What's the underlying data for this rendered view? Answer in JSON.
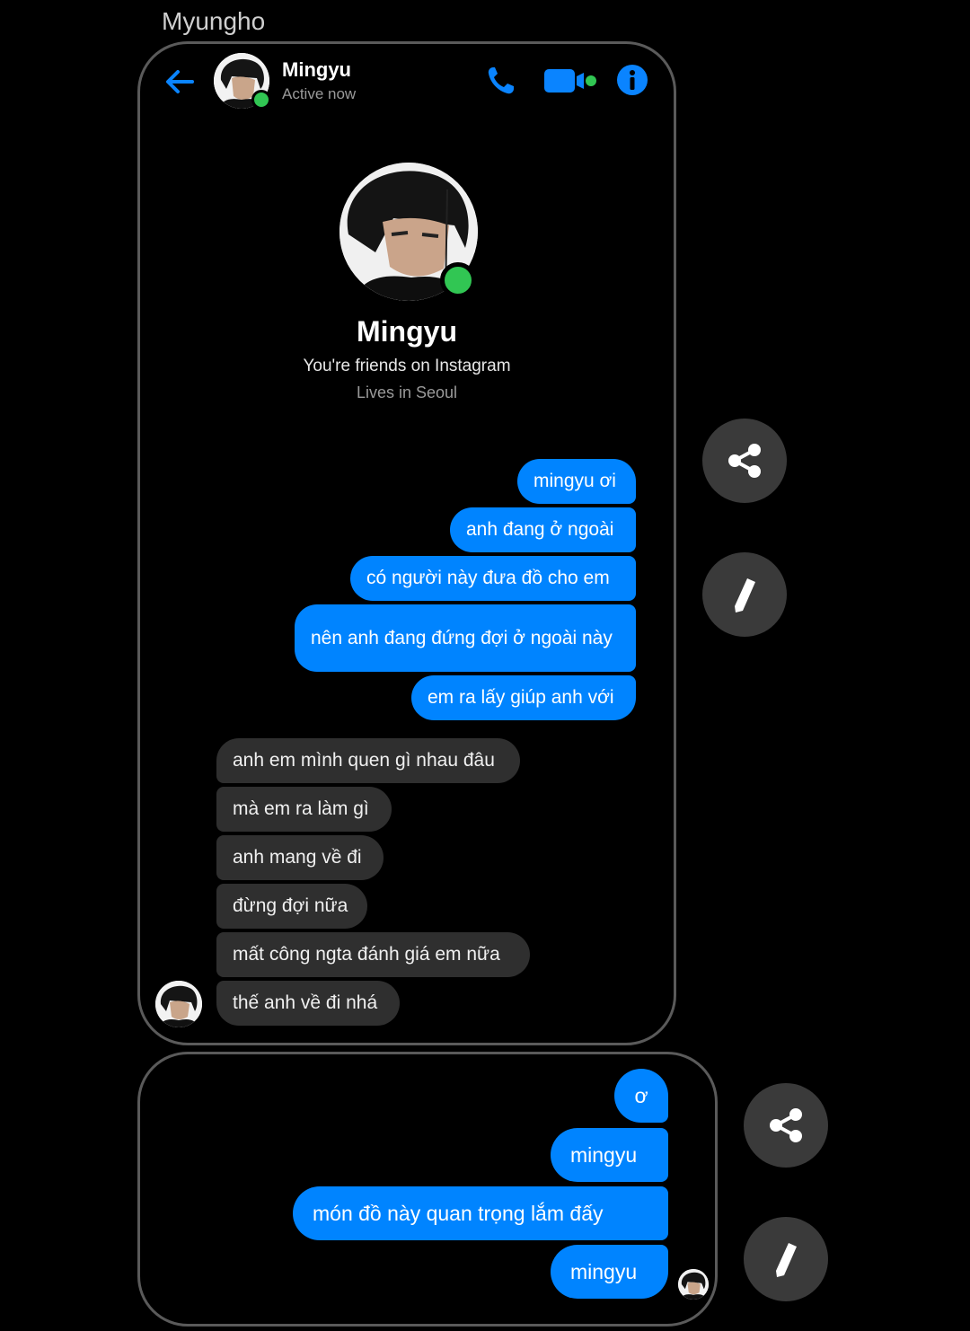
{
  "sender": "Myungho",
  "header": {
    "name": "Mingyu",
    "status": "Active now"
  },
  "profile": {
    "name": "Mingyu",
    "friends": "You're friends on Instagram",
    "location": "Lives in Seoul"
  },
  "messages1": [
    {
      "dir": "out",
      "text": "mingyu ơi"
    },
    {
      "dir": "out",
      "text": "anh đang ở ngoài"
    },
    {
      "dir": "out",
      "text": "có người này đưa đồ cho em"
    },
    {
      "dir": "out",
      "text": "nên anh đang đứng đợi ở ngoài này"
    },
    {
      "dir": "out",
      "text": "em ra lấy giúp anh với"
    },
    {
      "dir": "in",
      "text": "anh em mình quen gì nhau đâu"
    },
    {
      "dir": "in",
      "text": "mà em ra làm gì"
    },
    {
      "dir": "in",
      "text": "anh mang về đi"
    },
    {
      "dir": "in",
      "text": "đừng đợi nữa"
    },
    {
      "dir": "in",
      "text": "mất công ngta đánh giá em nữa"
    },
    {
      "dir": "in",
      "text": "thế anh về đi nhá"
    }
  ],
  "messages2": [
    {
      "dir": "out",
      "text": "ơ"
    },
    {
      "dir": "out",
      "text": "mingyu"
    },
    {
      "dir": "out",
      "text": "món đồ này quan trọng lắm đấy"
    },
    {
      "dir": "out",
      "text": "mingyu"
    }
  ],
  "colors": {
    "accent": "#0084ff",
    "online": "#31c653",
    "incoming_bubble": "#2f2f2f"
  },
  "icons": [
    "back-arrow-icon",
    "phone-icon",
    "video-camera-icon",
    "info-icon",
    "share-icon",
    "pencil-icon"
  ]
}
